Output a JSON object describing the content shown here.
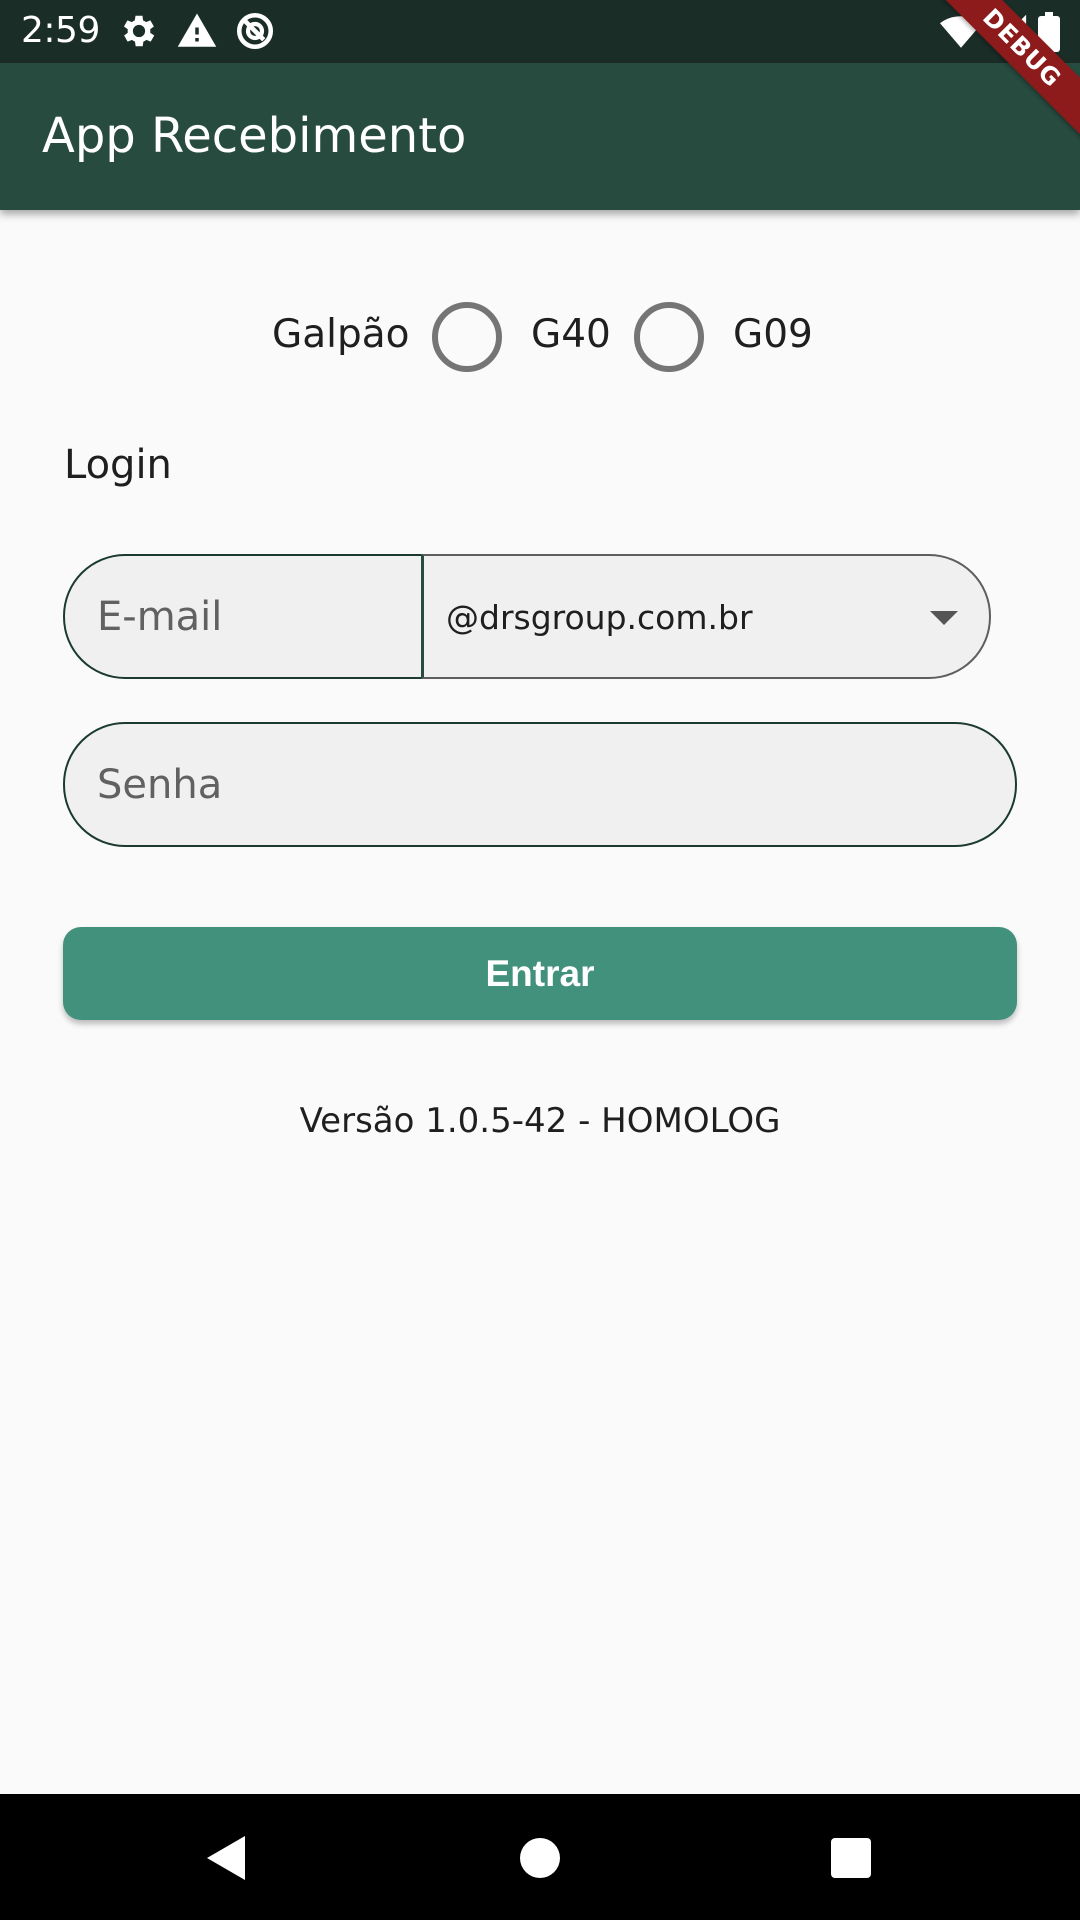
{
  "status_bar": {
    "time": "2:59",
    "icons": [
      "gear-icon",
      "warning-icon",
      "sync-icon",
      "wifi-icon",
      "signal-icon",
      "battery-icon"
    ]
  },
  "debug_banner": "DEBUG",
  "app_bar": {
    "title": "App Recebimento"
  },
  "galpao": {
    "label": "Galpão",
    "options": [
      {
        "label": "G40",
        "selected": false
      },
      {
        "label": "G09",
        "selected": false
      }
    ]
  },
  "login": {
    "title": "Login",
    "email_placeholder": "E-mail",
    "domain_value": "@drsgroup.com.br",
    "password_placeholder": "Senha",
    "submit_label": "Entrar"
  },
  "version": "Versão 1.0.5-42 - HOMOLOG",
  "colors": {
    "status_bar": "#1b2d27",
    "app_bar": "#274b3f",
    "primary_button": "#42917d",
    "debug_banner": "#8e1b1b",
    "background": "#fafafa"
  }
}
